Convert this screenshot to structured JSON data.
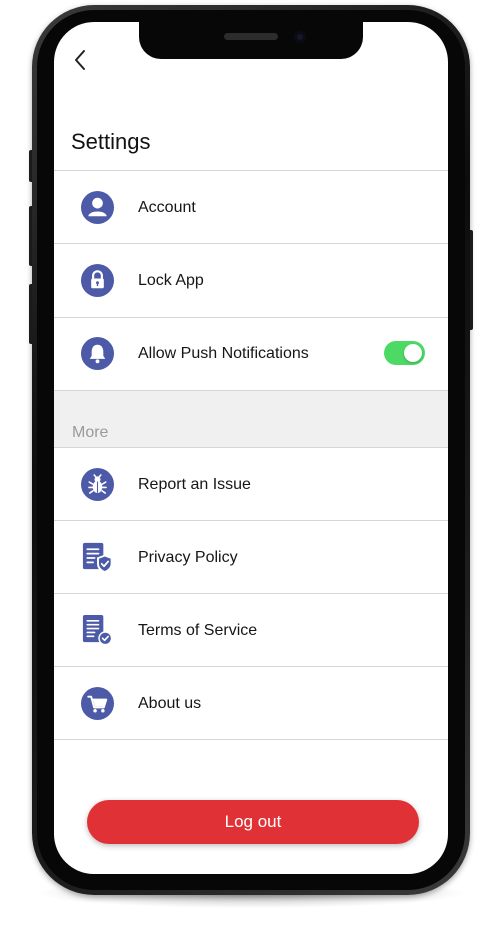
{
  "header": {
    "title": "Settings"
  },
  "settings": {
    "items": [
      {
        "label": "Account",
        "icon": "user-icon"
      },
      {
        "label": "Lock App",
        "icon": "lock-icon"
      },
      {
        "label": "Allow Push Notifications",
        "icon": "bell-icon",
        "toggle_on": true
      }
    ]
  },
  "more": {
    "section_label": "More",
    "items": [
      {
        "label": "Report an Issue",
        "icon": "bug-icon"
      },
      {
        "label": "Privacy Policy",
        "icon": "privacy-document-icon"
      },
      {
        "label": "Terms of Service",
        "icon": "terms-document-icon"
      },
      {
        "label": "About us",
        "icon": "cart-icon"
      }
    ]
  },
  "logout": {
    "label": "Log out"
  },
  "colors": {
    "icon_accent": "#4d5aa7",
    "toggle_on": "#4cd964",
    "logout_button": "#e03236",
    "section_band": "#f0f0f0"
  }
}
